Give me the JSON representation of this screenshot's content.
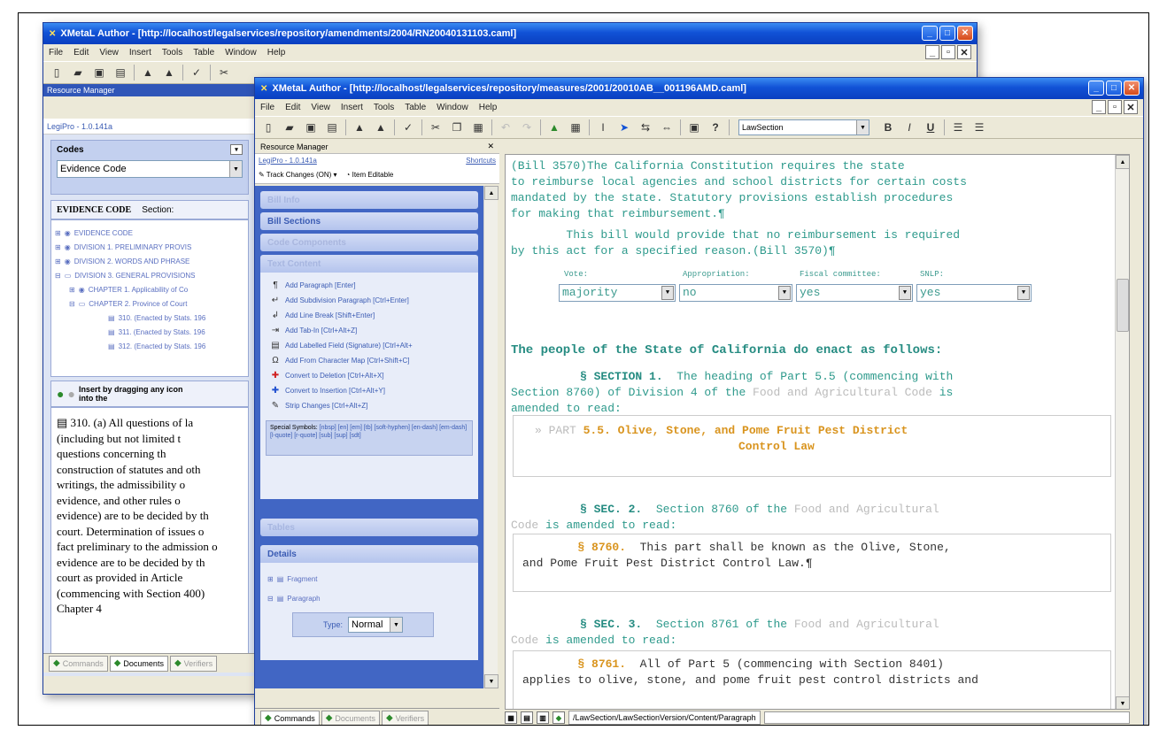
{
  "window_back": {
    "title": "XMetaL Author - [http://localhost/legalservices/repository/amendments/2004/RN20040131103.caml]",
    "menu": [
      "File",
      "Edit",
      "View",
      "Insert",
      "Tools",
      "Table",
      "Window",
      "Help"
    ],
    "resource_manager_label": "Resource Manager",
    "legipro_version": "LegiPro - 1.0.141a",
    "codes_label": "Codes",
    "codes_value": "Evidence Code",
    "evidence_code_label": "EVIDENCE CODE",
    "section_label": "Section:",
    "tree": [
      "EVIDENCE CODE",
      "DIVISION 1. PRELIMINARY PROVIS",
      "DIVISION 2. WORDS AND PHRASE",
      "DIVISION 3. GENERAL PROVISIONS",
      "CHAPTER 1. Applicability of Co",
      "CHAPTER 2. Province of Court",
      "310. (Enacted by Stats. 196",
      "311. (Enacted by Stats. 196",
      "312. (Enacted by Stats. 196"
    ],
    "insert_hint": "Insert by dragging any icon into the",
    "body_text": [
      "310. (a) All questions of la",
      "(including but not limited t",
      "questions concerning th",
      "construction of statutes and oth",
      "writings, the admissibility o",
      "evidence, and other rules o",
      "evidence) are to be decided by th",
      "court. Determination of issues o",
      "fact preliminary to the admission o",
      "evidence are to be decided by th",
      "court as provided in Article",
      "(commencing with Section 400)",
      "Chapter 4"
    ],
    "tabs": [
      "Commands",
      "Documents",
      "Verifiers"
    ]
  },
  "window_front": {
    "title": "XMetaL Author - [http://localhost/legalservices/repository/measures/2001/20010AB__001196AMD.caml]",
    "menu": [
      "File",
      "Edit",
      "View",
      "Insert",
      "Tools",
      "Table",
      "Window",
      "Help"
    ],
    "style_select": "LawSection",
    "resource_manager_label": "Resource Manager",
    "legipro_version": "LegiPro - 1.0.141a",
    "shortcuts_link": "Shortcuts",
    "track_changes": "Track Changes (ON)",
    "item_editable": "Item Editable",
    "sections": {
      "bill_info": "Bill Info",
      "bill_sections": "Bill Sections",
      "code_components": "Code Components",
      "text_content": "Text Content",
      "tables": "Tables",
      "details": "Details"
    },
    "actions": [
      {
        "icon": "paragraph-icon",
        "glyph": "¶",
        "label": "Add Paragraph [Enter]"
      },
      {
        "icon": "subdivision-icon",
        "glyph": "↵",
        "label": "Add Subdivision Paragraph [Ctrl+Enter]"
      },
      {
        "icon": "line-break-icon",
        "glyph": "↲",
        "label": "Add Line Break [Shift+Enter]"
      },
      {
        "icon": "tab-icon",
        "glyph": "⇥",
        "label": "Add Tab-In [Ctrl+Alt+Z]"
      },
      {
        "icon": "labelled-field-icon",
        "glyph": "▤",
        "label": "Add Labelled Field (Signature) [Ctrl+Alt+"
      },
      {
        "icon": "character-map-icon",
        "glyph": "Ω",
        "label": "Add From Character Map [Ctrl+Shift+C]"
      },
      {
        "icon": "deletion-icon",
        "glyph": "✚",
        "label": "Convert to Deletion [Ctrl+Alt+X]"
      },
      {
        "icon": "insertion-icon",
        "glyph": "✚",
        "label": "Convert to Insertion [Ctrl+Alt+Y]"
      },
      {
        "icon": "strip-changes-icon",
        "glyph": "✎",
        "label": "Strip Changes [Ctrl+Alt+Z]"
      }
    ],
    "special_symbols_label": "Special Symbols:",
    "special_symbols_list": "[nbsp] [en] [em] [tb] [soft-hyphen] [en-dash] [em-dash] [l-quote] [r-quote] [sub] [sup] [sdt]",
    "details_tree": [
      "Fragment",
      "Paragraph"
    ],
    "type_label": "Type:",
    "type_value": "Normal",
    "tabs": [
      "Commands",
      "Documents",
      "Verifiers"
    ],
    "status_path": "/LawSection/LawSectionVersion/Content/Paragraph",
    "doc": {
      "digest_1": [
        "(Bill 3570)The California Constitution requires the state",
        "to reimburse local agencies and school districts for certain costs",
        "mandated by the state. Statutory provisions establish procedures",
        "for making that reimbursement.¶"
      ],
      "digest_2": [
        "        This bill would provide that no reimbursement is required",
        "by this act for a specified reason.(Bill 3570)¶"
      ],
      "vote_label": "Vote:",
      "vote_value": "majority",
      "appropriation_label": "Appropriation:",
      "appropriation_value": "no",
      "fiscal_label": "Fiscal committee:",
      "fiscal_value": "yes",
      "slmp_label": "SNLP:",
      "slmp_value": "yes",
      "enact": "The people of the State of California do enact as follows:",
      "sec1_a": "§ SECTION 1.",
      "sec1_b": "  The heading of Part 5.5 (commencing with",
      "sec1_c": "Section 8760) of Division 4 of the ",
      "sec1_grey": "Food and Agricultural Code",
      "sec1_d": " is",
      "sec1_e": "amended to read:",
      "part_a": "» PART ",
      "part_b": "5.5. Olive, Stone, and Pome Fruit Pest District",
      "part_c": "Control Law",
      "sec2_a": "§ SEC. 2.",
      "sec2_b": "  Section 8760 of the ",
      "sec2_grey": "Food and Agricultural",
      "sec2_c": "Code",
      "sec2_d": " is amended to read:",
      "s8760_a": "§ 8760.",
      "s8760_b": "  This part shall be known as the Olive, Stone,",
      "s8760_c": "and Pome Fruit Pest District Control Law.¶",
      "sec3_a": "§ SEC. 3.",
      "sec3_b": "  Section 8761 of the ",
      "sec3_grey": "Food and Agricultural",
      "sec3_c": "Code",
      "sec3_d": " is amended to read:",
      "s8761_a": "§ 8761.",
      "s8761_b": "  All of Part 5 (commencing with Section 8401)",
      "s8761_c": "applies to olive, stone, and pome fruit pest control districts and"
    }
  },
  "colors": {
    "title_blue": "#1152d6",
    "panel_blue": "#4166c4",
    "teal_text": "#2e9a8c",
    "orange_text": "#d9941e"
  }
}
